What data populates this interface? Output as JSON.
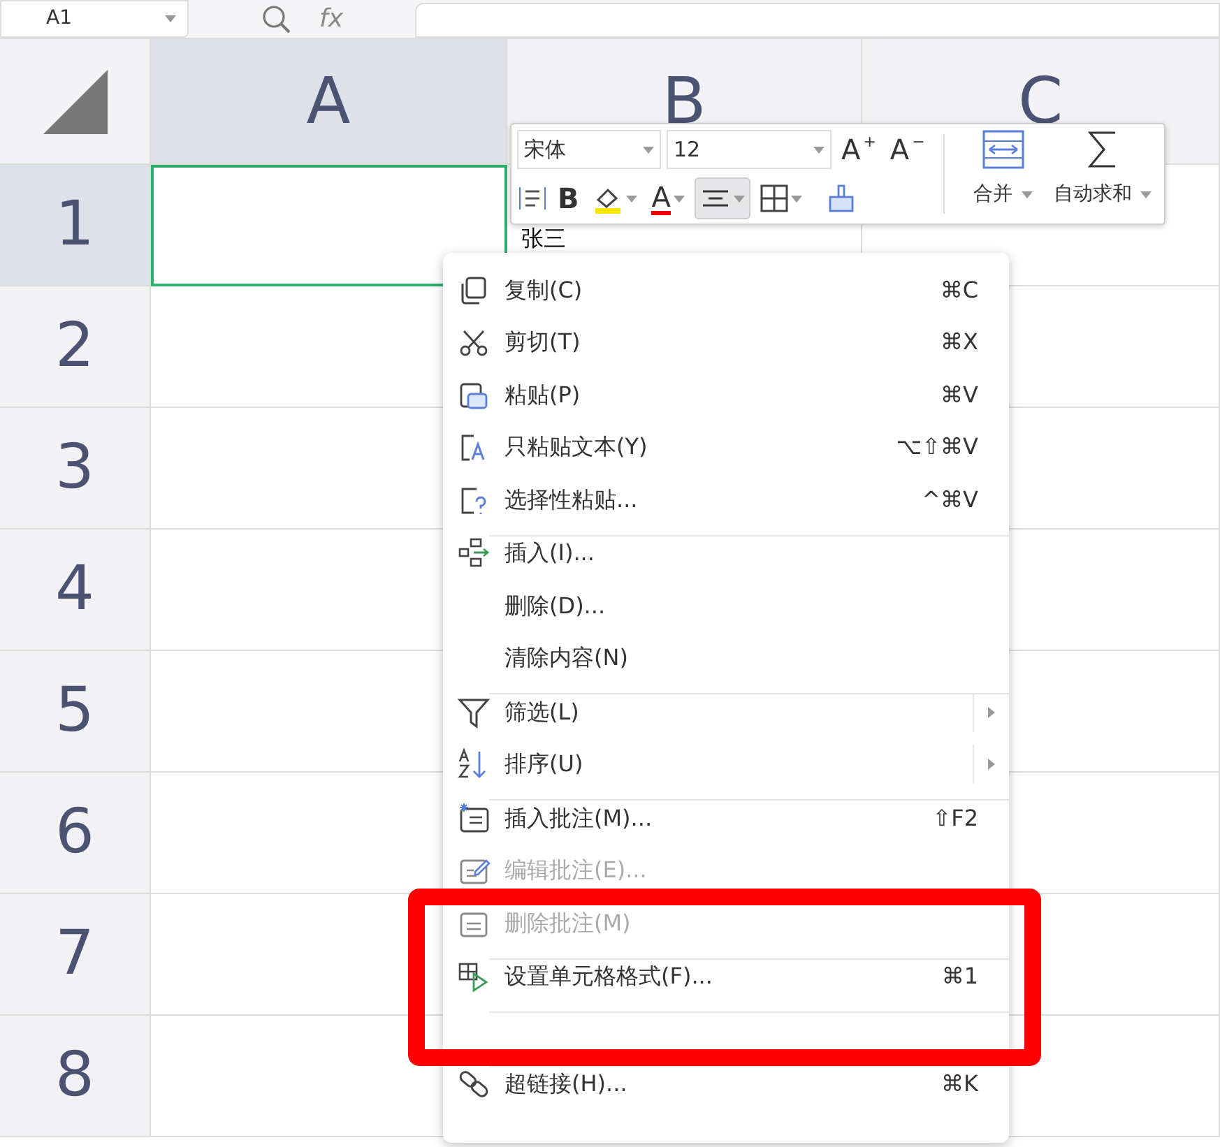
{
  "formula_bar": {
    "name_box": "A1",
    "fx": "fx"
  },
  "sheet": {
    "columns": [
      {
        "label": "A",
        "selected": true
      },
      {
        "label": "B",
        "selected": false
      },
      {
        "label": "C",
        "selected": false
      }
    ],
    "rows": [
      {
        "label": "1",
        "selected": true
      },
      {
        "label": "2",
        "selected": false
      },
      {
        "label": "3",
        "selected": false
      },
      {
        "label": "4",
        "selected": false
      },
      {
        "label": "5",
        "selected": false
      },
      {
        "label": "6",
        "selected": false
      },
      {
        "label": "7",
        "selected": false
      },
      {
        "label": "8",
        "selected": false
      }
    ],
    "cell_b1": "张三"
  },
  "toolbar": {
    "font": "宋体",
    "size": "12",
    "grow": "A",
    "grow_mark": "+",
    "shrink": "A",
    "shrink_mark": "−",
    "bold": "B",
    "font_color": "A",
    "merge": "合并",
    "autosum": "自动求和",
    "align_selected": true
  },
  "menu": [
    {
      "kind": "item",
      "label": "复制(C)",
      "shortcut": "⌘C",
      "disabled": false
    },
    {
      "kind": "item",
      "label": "剪切(T)",
      "shortcut": "⌘X",
      "disabled": false
    },
    {
      "kind": "item",
      "label": "粘贴(P)",
      "shortcut": "⌘V",
      "disabled": false
    },
    {
      "kind": "item",
      "label": "只粘贴文本(Y)",
      "shortcut": "⌥⇧⌘V",
      "disabled": false
    },
    {
      "kind": "item",
      "label": "选择性粘贴...",
      "shortcut": "^⌘V",
      "disabled": false
    },
    {
      "kind": "separator"
    },
    {
      "kind": "item",
      "label": "插入(I)...",
      "disabled": false
    },
    {
      "kind": "item",
      "label": "删除(D)...",
      "disabled": false
    },
    {
      "kind": "item",
      "label": "清除内容(N)",
      "disabled": false
    },
    {
      "kind": "separator"
    },
    {
      "kind": "submenu",
      "label": "筛选(L)",
      "disabled": false
    },
    {
      "kind": "submenu",
      "label": "排序(U)",
      "disabled": false
    },
    {
      "kind": "separator"
    },
    {
      "kind": "item",
      "label": "插入批注(M)...",
      "shortcut": "⇧F2",
      "disabled": false
    },
    {
      "kind": "item",
      "label": "编辑批注(E)...",
      "disabled": true
    },
    {
      "kind": "item",
      "label": "删除批注(M)",
      "disabled": true
    },
    {
      "kind": "separator"
    },
    {
      "kind": "item",
      "label": "设置单元格格式(F)...",
      "shortcut": "⌘1",
      "disabled": false
    },
    {
      "kind": "separator"
    },
    {
      "kind": "covered"
    },
    {
      "kind": "separator"
    },
    {
      "kind": "item",
      "label": "超链接(H)...",
      "shortcut": "⌘K",
      "disabled": false
    }
  ],
  "annotation": {
    "kind": "highlight-frame",
    "color": "#ff0000"
  }
}
